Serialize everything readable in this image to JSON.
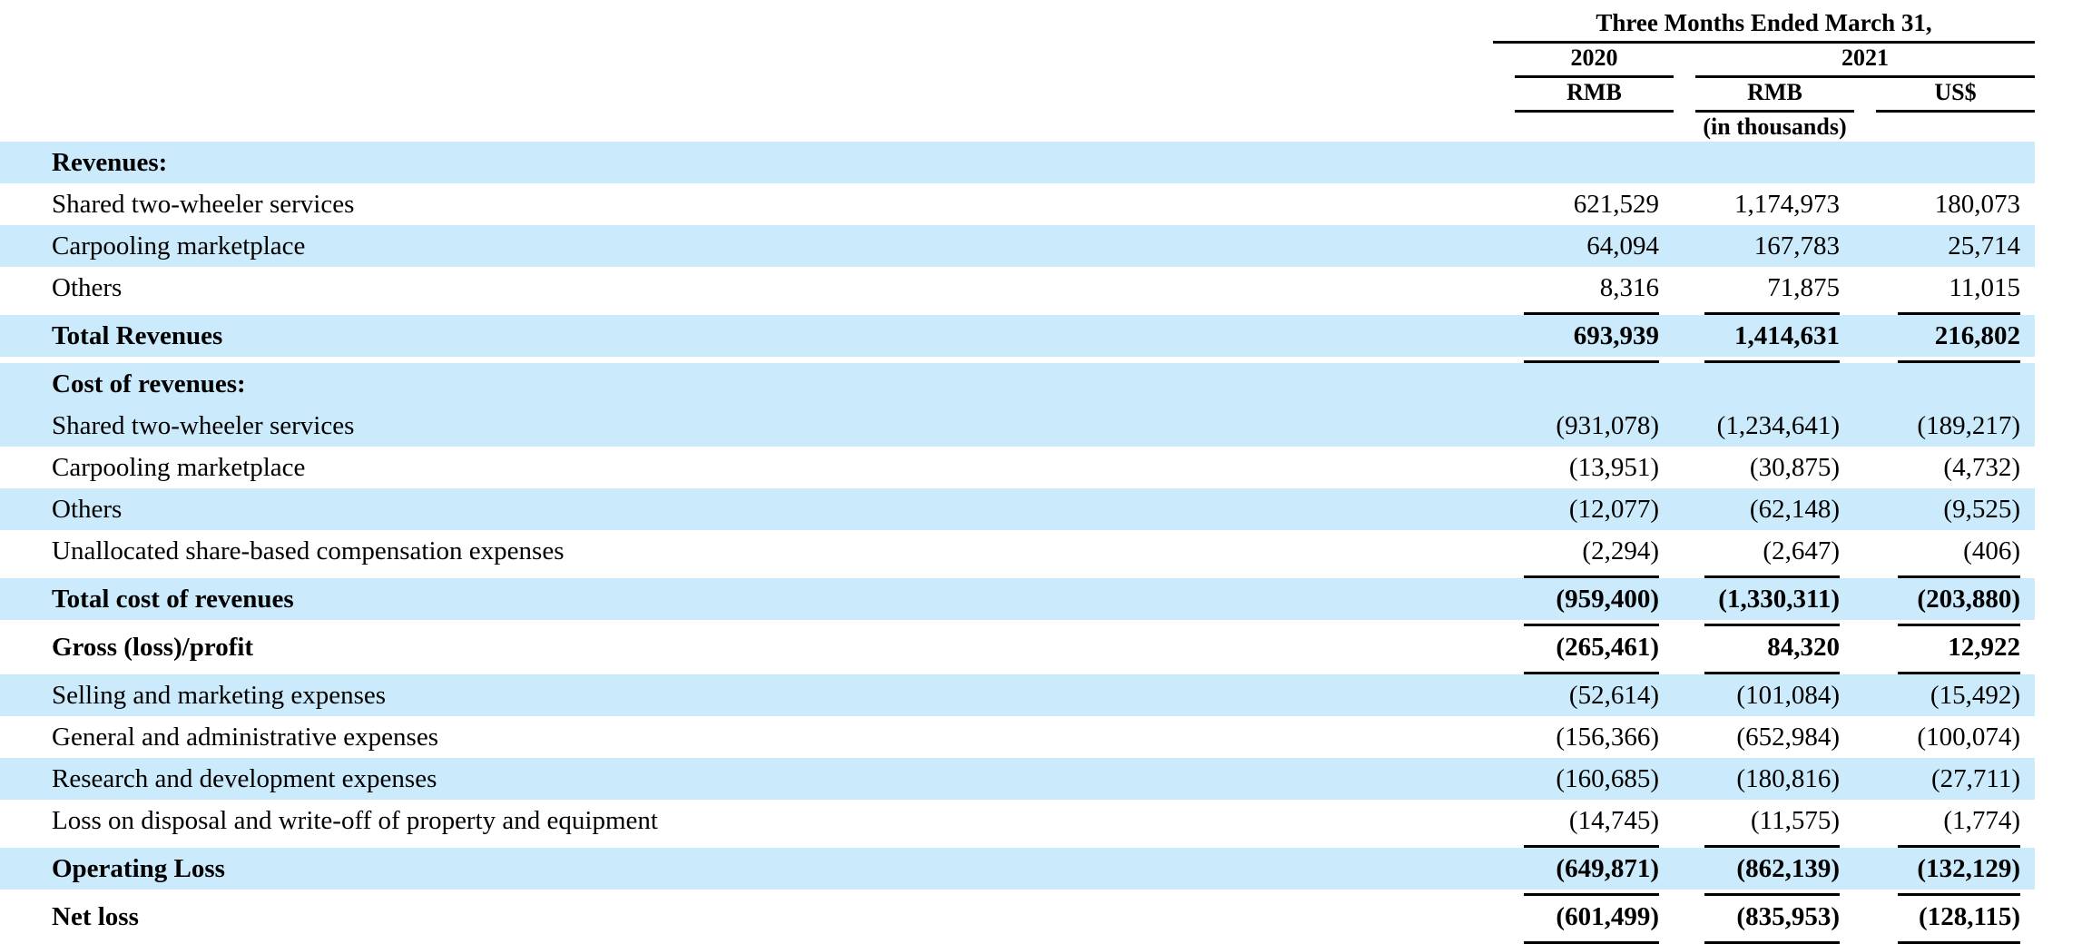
{
  "header": {
    "period_title": "Three Months Ended March 31,",
    "year_left": "2020",
    "year_right": "2021",
    "currency_col1": "RMB",
    "currency_col2": "RMB",
    "currency_col3": "US$",
    "units_note": "(in thousands)"
  },
  "colors": {
    "highlight": "#cbeafb",
    "text": "#000000",
    "background": "#ffffff"
  },
  "chart_data": {
    "type": "table",
    "title": "Three Months Ended March 31,",
    "columns": [
      "",
      "2020 RMB",
      "2021 RMB",
      "2021 US$"
    ],
    "units": "(in thousands)",
    "rows": [
      {
        "label": "Revenues:",
        "values": [
          "",
          "",
          ""
        ]
      },
      {
        "label": "Shared two-wheeler services",
        "values": [
          "621,529",
          "1,174,973",
          "180,073"
        ]
      },
      {
        "label": "Carpooling marketplace",
        "values": [
          "64,094",
          "167,783",
          "25,714"
        ]
      },
      {
        "label": "Others",
        "values": [
          "8,316",
          "71,875",
          "11,015"
        ]
      },
      {
        "label": "Total Revenues",
        "values": [
          "693,939",
          "1,414,631",
          "216,802"
        ]
      },
      {
        "label": "Cost of revenues:",
        "values": [
          "",
          "",
          ""
        ]
      },
      {
        "label": "Shared two-wheeler services",
        "values": [
          "(931,078)",
          "(1,234,641)",
          "(189,217)"
        ]
      },
      {
        "label": "Carpooling marketplace",
        "values": [
          "(13,951)",
          "(30,875)",
          "(4,732)"
        ]
      },
      {
        "label": "Others",
        "values": [
          "(12,077)",
          "(62,148)",
          "(9,525)"
        ]
      },
      {
        "label": "Unallocated share-based compensation expenses",
        "values": [
          "(2,294)",
          "(2,647)",
          "(406)"
        ]
      },
      {
        "label": "Total cost of revenues",
        "values": [
          "(959,400)",
          "(1,330,311)",
          "(203,880)"
        ]
      },
      {
        "label": "Gross (loss)/profit",
        "values": [
          "(265,461)",
          "84,320",
          "12,922"
        ]
      },
      {
        "label": "Selling and marketing expenses",
        "values": [
          "(52,614)",
          "(101,084)",
          "(15,492)"
        ]
      },
      {
        "label": "General and administrative expenses",
        "values": [
          "(156,366)",
          "(652,984)",
          "(100,074)"
        ]
      },
      {
        "label": "Research and development expenses",
        "values": [
          "(160,685)",
          "(180,816)",
          "(27,711)"
        ]
      },
      {
        "label": "Loss on disposal and write-off of property and equipment",
        "values": [
          "(14,745)",
          "(11,575)",
          "(1,774)"
        ]
      },
      {
        "label": "Operating Loss",
        "values": [
          "(649,871)",
          "(862,139)",
          "(132,129)"
        ]
      },
      {
        "label": "Net loss",
        "values": [
          "(601,499)",
          "(835,953)",
          "(128,115)"
        ]
      }
    ]
  }
}
